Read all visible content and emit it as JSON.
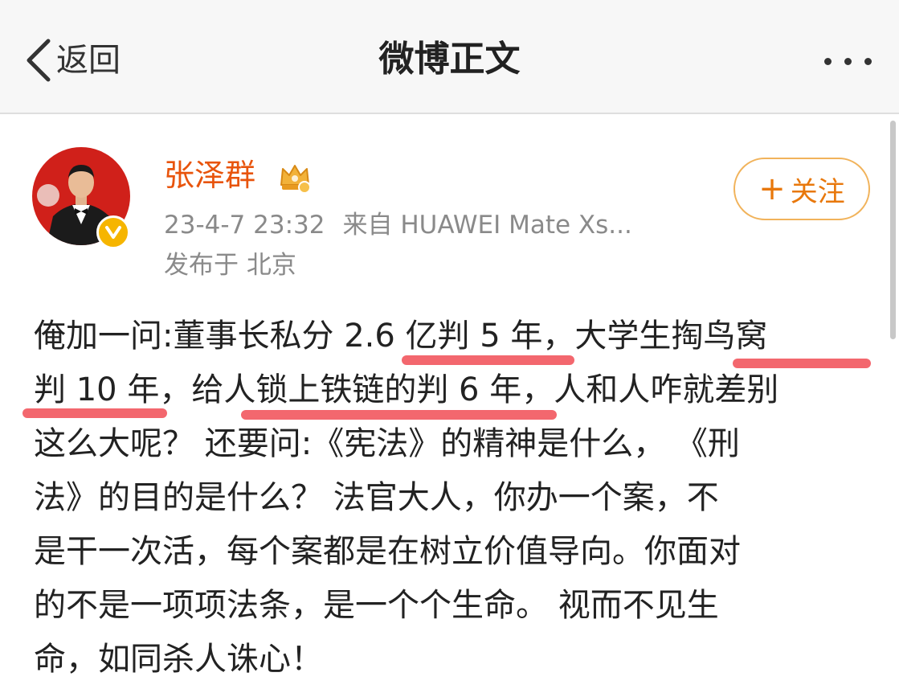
{
  "nav": {
    "back_label": "返回",
    "title": "微博正文",
    "more_icon": "more-dots-icon"
  },
  "post": {
    "author": {
      "name": "张泽群",
      "vip_icon": "vip-crown-icon",
      "verified_icon": "verified-v-icon"
    },
    "time": "23-4-7 23:32",
    "source": "来自 HUAWEI Mate Xs...",
    "location": "发布于 北京",
    "follow_label": "关注",
    "body_lines": [
      "俺加一问:董事长私分 2.6 亿判 5 年，大学生掏鸟窝",
      "判 10 年，给人锁上铁链的判 6 年，人和人咋就差别",
      "这么大呢？ 还要问:《宪法》的精神是什么， 《刑",
      "法》的目的是什么？ 法官大人，你办一个案，不",
      "是干一次活，每个案都是在树立价值导向。你面对",
      "的不是一项项法条，是一个个生命。 视而不见生",
      "命，如同杀人诛心！"
    ]
  },
  "colors": {
    "username": "#e8540c",
    "follow": "#e8780c",
    "highlight": "#f25a62",
    "meta": "#8a8a8a"
  }
}
